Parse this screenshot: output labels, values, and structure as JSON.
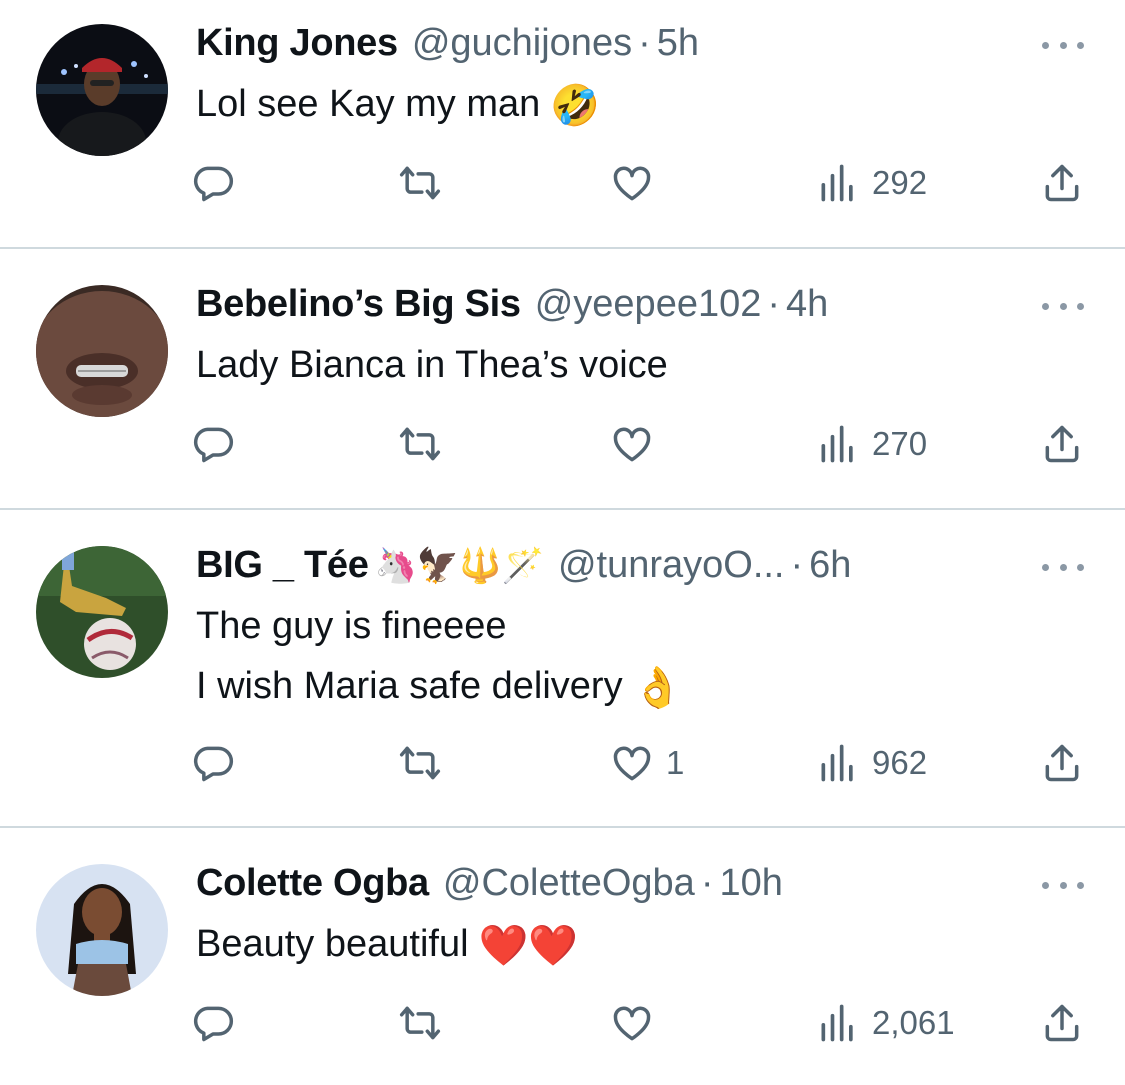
{
  "tweets": [
    {
      "name": "King Jones",
      "handle": "@guchijones",
      "time": "5h",
      "lines": [
        "Lol see Kay my man"
      ],
      "emoji": "🤣",
      "reply_count": "",
      "retweet_count": "",
      "like_count": "",
      "view_count": "292"
    },
    {
      "name": "Bebelino’s Big Sis",
      "handle": "@yeepee102",
      "time": "4h",
      "lines": [
        "Lady Bianca in Thea’s voice"
      ],
      "emoji": "",
      "reply_count": "",
      "retweet_count": "",
      "like_count": "",
      "view_count": "270"
    },
    {
      "name": "BIG _ Tée",
      "name_emojis": "🦄🦅🔱🪄",
      "handle": "@tunrayoO...",
      "time": "6h",
      "lines": [
        "The guy is fineeee",
        "I wish Maria safe delivery"
      ],
      "emoji": "👌",
      "reply_count": "",
      "retweet_count": "",
      "like_count": "1",
      "view_count": "962"
    },
    {
      "name": "Colette Ogba",
      "handle": "@ColetteOgba",
      "time": "10h",
      "lines": [
        "Beauty beautiful"
      ],
      "emoji": "❤️❤️",
      "reply_count": "",
      "retweet_count": "",
      "like_count": "",
      "view_count": "2,061"
    }
  ],
  "separator": "·",
  "colors": {
    "text_primary": "#0f1419",
    "text_secondary": "#536471",
    "divider": "#cfd9de"
  },
  "icons": [
    "reply-icon",
    "retweet-icon",
    "like-icon",
    "views-icon",
    "share-icon",
    "more-icon"
  ]
}
